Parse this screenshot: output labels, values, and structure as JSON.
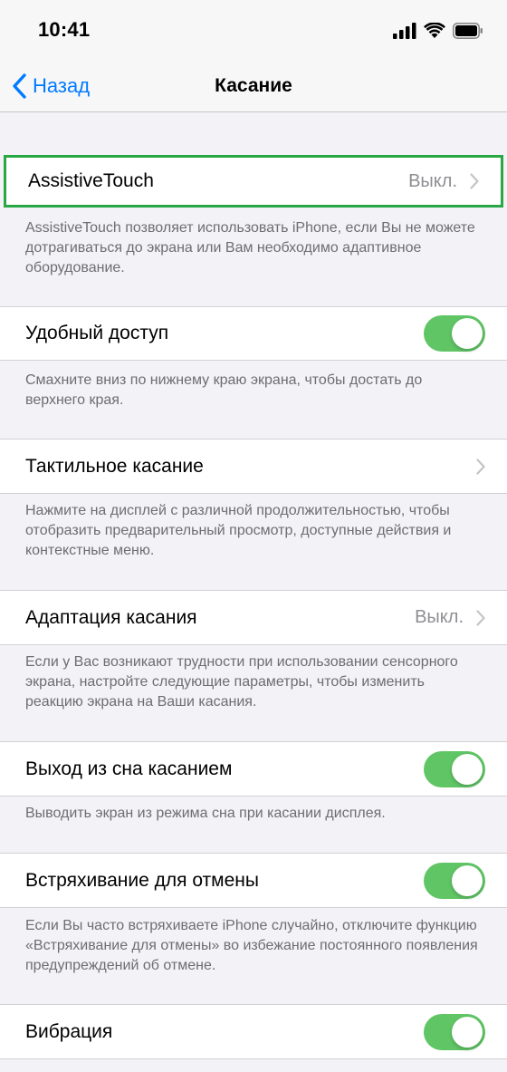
{
  "status_bar": {
    "time": "10:41"
  },
  "nav": {
    "back_label": "Назад",
    "title": "Касание"
  },
  "rows": {
    "assistive_touch": {
      "label": "AssistiveTouch",
      "value": "Выкл.",
      "footer": "AssistiveTouch позволяет использовать iPhone, если Вы не можете дотрагиваться до экрана или Вам необходимо адаптивное оборудование."
    },
    "reachability": {
      "label": "Удобный доступ",
      "on": true,
      "footer": "Смахните вниз по нижнему краю экрана, чтобы достать до верхнего края."
    },
    "haptic_touch": {
      "label": "Тактильное касание",
      "footer": "Нажмите на дисплей с различной продолжительностью, чтобы отобразить предварительный просмотр, доступные действия и контекстные меню."
    },
    "touch_accommodations": {
      "label": "Адаптация касания",
      "value": "Выкл.",
      "footer": "Если у Вас возникают трудности при использовании сенсорного экрана, настройте следующие параметры, чтобы изменить реакцию экрана на Ваши касания."
    },
    "tap_to_wake": {
      "label": "Выход из сна касанием",
      "on": true,
      "footer": "Выводить экран из режима сна при касании дисплея."
    },
    "shake_to_undo": {
      "label": "Встряхивание для отмены",
      "on": true,
      "footer": "Если Вы часто встряхиваете iPhone случайно, отключите функцию «Встряхивание для отмены» во избежание постоянного появления предупреждений об отмене."
    },
    "vibration": {
      "label": "Вибрация",
      "on": true
    }
  },
  "colors": {
    "accent": "#007aff",
    "toggle_on": "#5fc565",
    "highlight": "#28a745"
  }
}
